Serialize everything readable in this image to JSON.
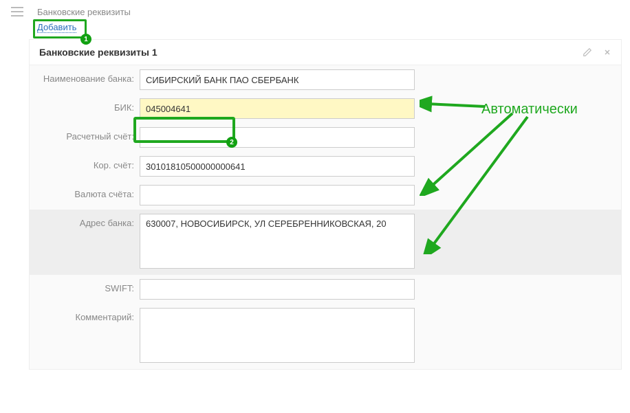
{
  "header": {
    "section_title": "Банковские реквизиты",
    "add_link": "Добавить"
  },
  "annotations": {
    "badge1": "1",
    "badge2": "2",
    "auto_label": "Автоматически"
  },
  "panel": {
    "title": "Банковские реквизиты 1",
    "fields": {
      "bank_name": {
        "label": "Наименование банка:",
        "value": "СИБИРСКИЙ БАНК ПАО СБЕРБАНК"
      },
      "bik": {
        "label": "БИК:",
        "value": "045004641"
      },
      "account": {
        "label": "Расчетный счёт:",
        "value": ""
      },
      "corr": {
        "label": "Кор. счёт:",
        "value": "30101810500000000641"
      },
      "currency": {
        "label": "Валюта счёта:",
        "value": ""
      },
      "address": {
        "label": "Адрес банка:",
        "value": "630007, НОВОСИБИРСК, УЛ СЕРЕБРЕННИКОВСКАЯ, 20"
      },
      "swift": {
        "label": "SWIFT:",
        "value": ""
      },
      "comment": {
        "label": "Комментарий:",
        "value": ""
      }
    }
  }
}
